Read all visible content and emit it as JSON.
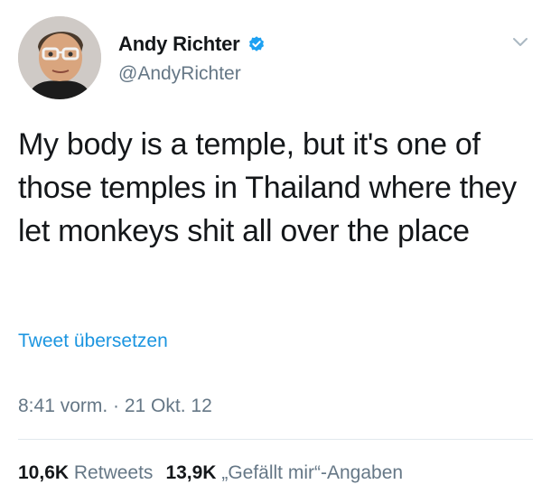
{
  "author": {
    "display_name": "Andy Richter",
    "handle": "@AndyRichter",
    "verified": true,
    "avatar_icon": "avatar"
  },
  "tweet": {
    "text": "My body is a temple, but it's one of those temples in Thailand where they let monkeys shit all over the place",
    "translate_label": "Tweet übersetzen",
    "timestamp": "8:41 vorm. · 21 Okt. 12"
  },
  "stats": {
    "retweets_count": "10,6K",
    "retweets_label": "Retweets",
    "likes_count": "13,9K",
    "likes_label": "„Gefällt mir“-Angaben"
  },
  "colors": {
    "link": "#1b95e0",
    "secondary_text": "#657786",
    "primary_text": "#14171a",
    "divider": "#e1e8ed",
    "verified": "#1da1f2"
  },
  "icons": [
    "verified-badge-icon",
    "chevron-down-icon"
  ]
}
